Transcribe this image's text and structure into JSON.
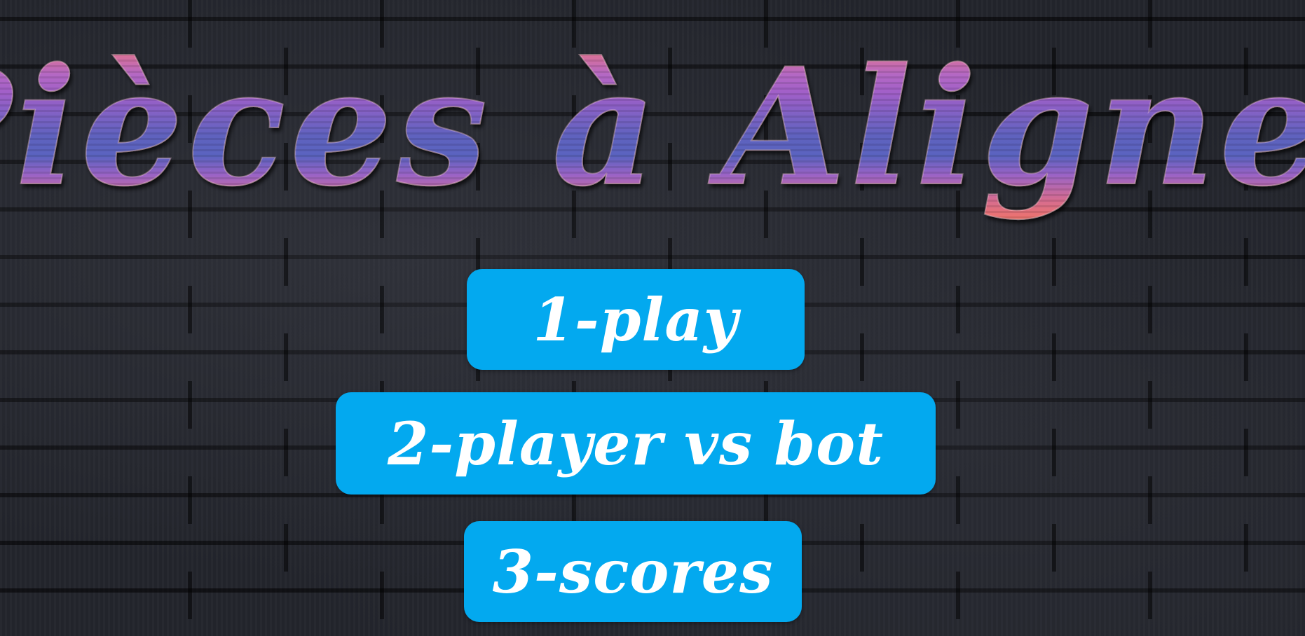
{
  "game": {
    "title": "Pièces à Aligner"
  },
  "menu": {
    "items": [
      {
        "label": "1-play"
      },
      {
        "label": "2-player vs bot"
      },
      {
        "label": "3-scores"
      }
    ]
  },
  "colors": {
    "background": "#23252c",
    "button": "#03a9ef",
    "button_text": "#ffffff",
    "title_pink": "#e86a7a",
    "title_purple": "#a868c8",
    "title_blue": "#5a64c0"
  }
}
